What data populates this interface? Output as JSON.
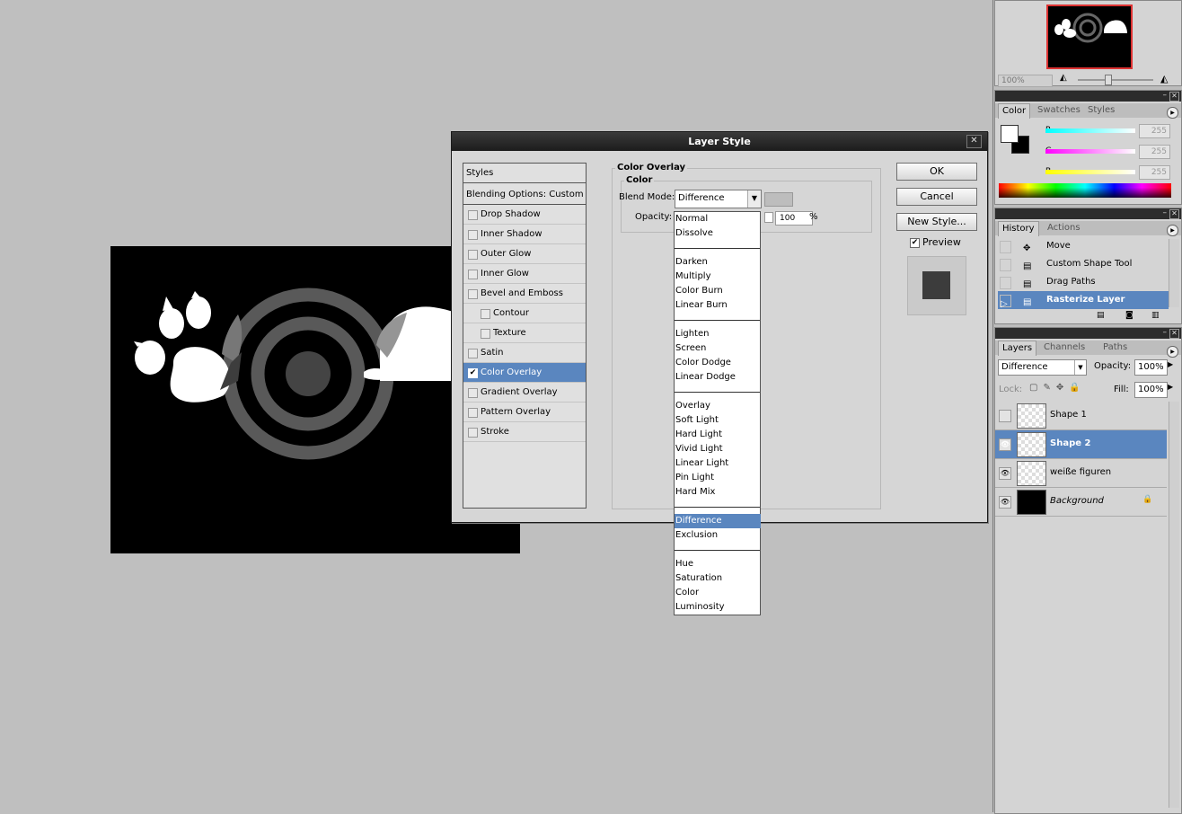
{
  "colors": {
    "accent": "#5a86bf",
    "dialog_bg": "#d6d6d6",
    "canvas_bg": "#bfbfbf"
  },
  "dialog": {
    "title": "Layer Style",
    "styles_list": {
      "header": "Styles",
      "blending_options": "Blending Options: Custom",
      "items": [
        {
          "label": "Drop Shadow",
          "checked": false,
          "indent": false
        },
        {
          "label": "Inner Shadow",
          "checked": false,
          "indent": false
        },
        {
          "label": "Outer Glow",
          "checked": false,
          "indent": false
        },
        {
          "label": "Inner Glow",
          "checked": false,
          "indent": false
        },
        {
          "label": "Bevel and Emboss",
          "checked": false,
          "indent": false
        },
        {
          "label": "Contour",
          "checked": false,
          "indent": true
        },
        {
          "label": "Texture",
          "checked": false,
          "indent": true
        },
        {
          "label": "Satin",
          "checked": false,
          "indent": false
        },
        {
          "label": "Color Overlay",
          "checked": true,
          "indent": false,
          "selected": true
        },
        {
          "label": "Gradient Overlay",
          "checked": false,
          "indent": false
        },
        {
          "label": "Pattern Overlay",
          "checked": false,
          "indent": false
        },
        {
          "label": "Stroke",
          "checked": false,
          "indent": false
        }
      ]
    },
    "panel": {
      "group_title": "Color Overlay",
      "subgroup_title": "Color",
      "blend_mode_label": "Blend Mode:",
      "blend_mode_value": "Difference",
      "opacity_label": "Opacity:",
      "opacity_value": "100",
      "opacity_unit": "%"
    },
    "buttons": {
      "ok": "OK",
      "cancel": "Cancel",
      "new_style": "New Style...",
      "preview": "Preview"
    }
  },
  "blend_modes": [
    [
      "Normal",
      "Dissolve"
    ],
    [
      "Darken",
      "Multiply",
      "Color Burn",
      "Linear Burn"
    ],
    [
      "Lighten",
      "Screen",
      "Color Dodge",
      "Linear Dodge"
    ],
    [
      "Overlay",
      "Soft Light",
      "Hard Light",
      "Vivid Light",
      "Linear Light",
      "Pin Light",
      "Hard Mix"
    ],
    [
      "Difference",
      "Exclusion"
    ],
    [
      "Hue",
      "Saturation",
      "Color",
      "Luminosity"
    ]
  ],
  "navigator": {
    "zoom": "100%"
  },
  "color_palette": {
    "tabs": [
      "Color",
      "Swatches",
      "Styles"
    ],
    "channels": [
      {
        "label": "R",
        "value": "255"
      },
      {
        "label": "G",
        "value": "255"
      },
      {
        "label": "B",
        "value": "255"
      }
    ]
  },
  "history_palette": {
    "tabs": [
      "History",
      "Actions"
    ],
    "items": [
      {
        "label": "Move",
        "selected": false
      },
      {
        "label": "Custom Shape Tool",
        "selected": false
      },
      {
        "label": "Drag Paths",
        "selected": false
      },
      {
        "label": "Rasterize Layer",
        "selected": true
      }
    ]
  },
  "layers_palette": {
    "tabs": [
      "Layers",
      "Channels",
      "Paths"
    ],
    "blend_mode": "Difference",
    "opacity_label": "Opacity:",
    "opacity_value": "100%",
    "lock_label": "Lock:",
    "fill_label": "Fill:",
    "fill_value": "100%",
    "layers": [
      {
        "name": "Shape 1",
        "visible": false,
        "selected": false,
        "italic": false
      },
      {
        "name": "Shape 2",
        "visible": true,
        "selected": true,
        "italic": false
      },
      {
        "name": "weiße figuren",
        "visible": true,
        "selected": false,
        "italic": false
      },
      {
        "name": "Background",
        "visible": true,
        "selected": false,
        "italic": true,
        "locked": true
      }
    ]
  }
}
